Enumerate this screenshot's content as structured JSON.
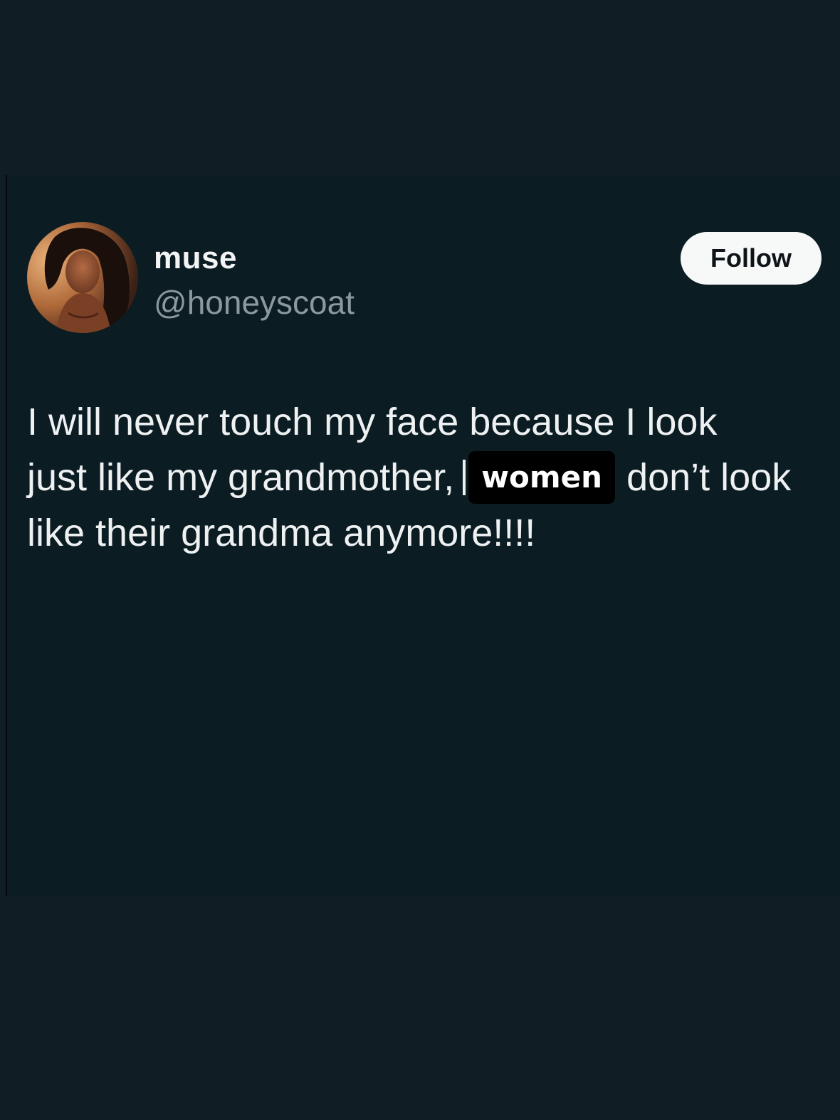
{
  "tweet": {
    "author": {
      "display_name": "muse",
      "handle": "@honeyscoat",
      "avatar_icon": "profile-photo"
    },
    "follow_label": "Follow",
    "text": {
      "line1": "I will never touch my face because I look",
      "line2_before": "just like my grandmother,",
      "line2_overlay": "women",
      "line2_after": "don’t look",
      "line3": "like their grandma anymore!!!!"
    }
  },
  "colors": {
    "page_background": "#101d24",
    "card_background": "#0c1c23",
    "text_primary": "#eef1f2",
    "text_secondary": "#8c98a0",
    "follow_button_bg": "#f7f9f9",
    "overlay_bg": "#000000"
  }
}
